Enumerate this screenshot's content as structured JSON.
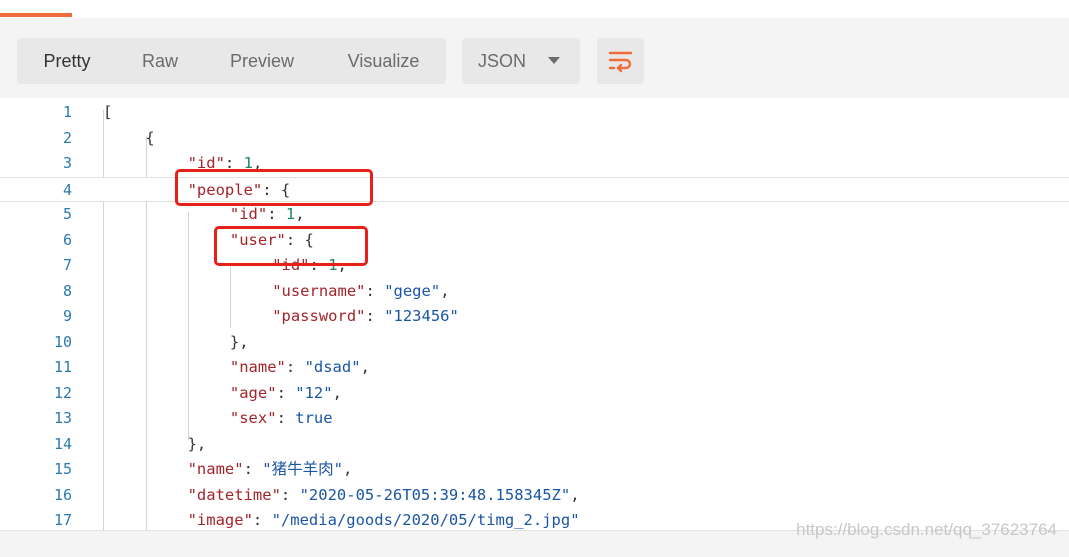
{
  "toolbar": {
    "tabs": [
      {
        "label": "Pretty",
        "active": true
      },
      {
        "label": "Raw",
        "active": false
      },
      {
        "label": "Preview",
        "active": false
      },
      {
        "label": "Visualize",
        "active": false
      }
    ],
    "format_select": {
      "value": "JSON"
    },
    "wrap_icon": "wrap-lines-icon",
    "accent_color": "#f26b3a"
  },
  "editor": {
    "lines": [
      {
        "n": "1",
        "indent": 0,
        "tokens": [
          [
            "punc",
            "["
          ]
        ]
      },
      {
        "n": "2",
        "indent": 1,
        "tokens": [
          [
            "punc",
            "{"
          ]
        ]
      },
      {
        "n": "3",
        "indent": 2,
        "tokens": [
          [
            "key",
            "\"id\""
          ],
          [
            "punc",
            ": "
          ],
          [
            "num",
            "1"
          ],
          [
            "punc",
            ","
          ]
        ]
      },
      {
        "n": "4",
        "indent": 2,
        "current": true,
        "tokens": [
          [
            "key",
            "\"people\""
          ],
          [
            "punc",
            ": {"
          ]
        ]
      },
      {
        "n": "5",
        "indent": 3,
        "tokens": [
          [
            "key",
            "\"id\""
          ],
          [
            "punc",
            ": "
          ],
          [
            "num",
            "1"
          ],
          [
            "punc",
            ","
          ]
        ]
      },
      {
        "n": "6",
        "indent": 3,
        "tokens": [
          [
            "key",
            "\"user\""
          ],
          [
            "punc",
            ": {"
          ]
        ]
      },
      {
        "n": "7",
        "indent": 4,
        "tokens": [
          [
            "key",
            "\"id\""
          ],
          [
            "punc",
            ": "
          ],
          [
            "num",
            "1"
          ],
          [
            "punc",
            ","
          ]
        ]
      },
      {
        "n": "8",
        "indent": 4,
        "tokens": [
          [
            "key",
            "\"username\""
          ],
          [
            "punc",
            ": "
          ],
          [
            "str",
            "\"gege\""
          ],
          [
            "punc",
            ","
          ]
        ]
      },
      {
        "n": "9",
        "indent": 4,
        "tokens": [
          [
            "key",
            "\"password\""
          ],
          [
            "punc",
            ": "
          ],
          [
            "str",
            "\"123456\""
          ]
        ]
      },
      {
        "n": "10",
        "indent": 3,
        "tokens": [
          [
            "punc",
            "},"
          ]
        ]
      },
      {
        "n": "11",
        "indent": 3,
        "tokens": [
          [
            "key",
            "\"name\""
          ],
          [
            "punc",
            ": "
          ],
          [
            "str",
            "\"dsad\""
          ],
          [
            "punc",
            ","
          ]
        ]
      },
      {
        "n": "12",
        "indent": 3,
        "tokens": [
          [
            "key",
            "\"age\""
          ],
          [
            "punc",
            ": "
          ],
          [
            "str",
            "\"12\""
          ],
          [
            "punc",
            ","
          ]
        ]
      },
      {
        "n": "13",
        "indent": 3,
        "tokens": [
          [
            "key",
            "\"sex\""
          ],
          [
            "punc",
            ": "
          ],
          [
            "bool",
            "true"
          ]
        ]
      },
      {
        "n": "14",
        "indent": 2,
        "tokens": [
          [
            "punc",
            "},"
          ]
        ]
      },
      {
        "n": "15",
        "indent": 2,
        "tokens": [
          [
            "key",
            "\"name\""
          ],
          [
            "punc",
            ": "
          ],
          [
            "str",
            "\"猪牛羊肉\""
          ],
          [
            "punc",
            ","
          ]
        ]
      },
      {
        "n": "16",
        "indent": 2,
        "tokens": [
          [
            "key",
            "\"datetime\""
          ],
          [
            "punc",
            ": "
          ],
          [
            "str",
            "\"2020-05-26T05:39:48.158345Z\""
          ],
          [
            "punc",
            ","
          ]
        ]
      },
      {
        "n": "17",
        "indent": 2,
        "tokens": [
          [
            "key",
            "\"image\""
          ],
          [
            "punc",
            ": "
          ],
          [
            "str",
            "\"/media/goods/2020/05/timg_2.jpg\""
          ]
        ]
      }
    ]
  },
  "annotation_color": "#e8201a",
  "watermark": "https://blog.csdn.net/qq_37623764"
}
